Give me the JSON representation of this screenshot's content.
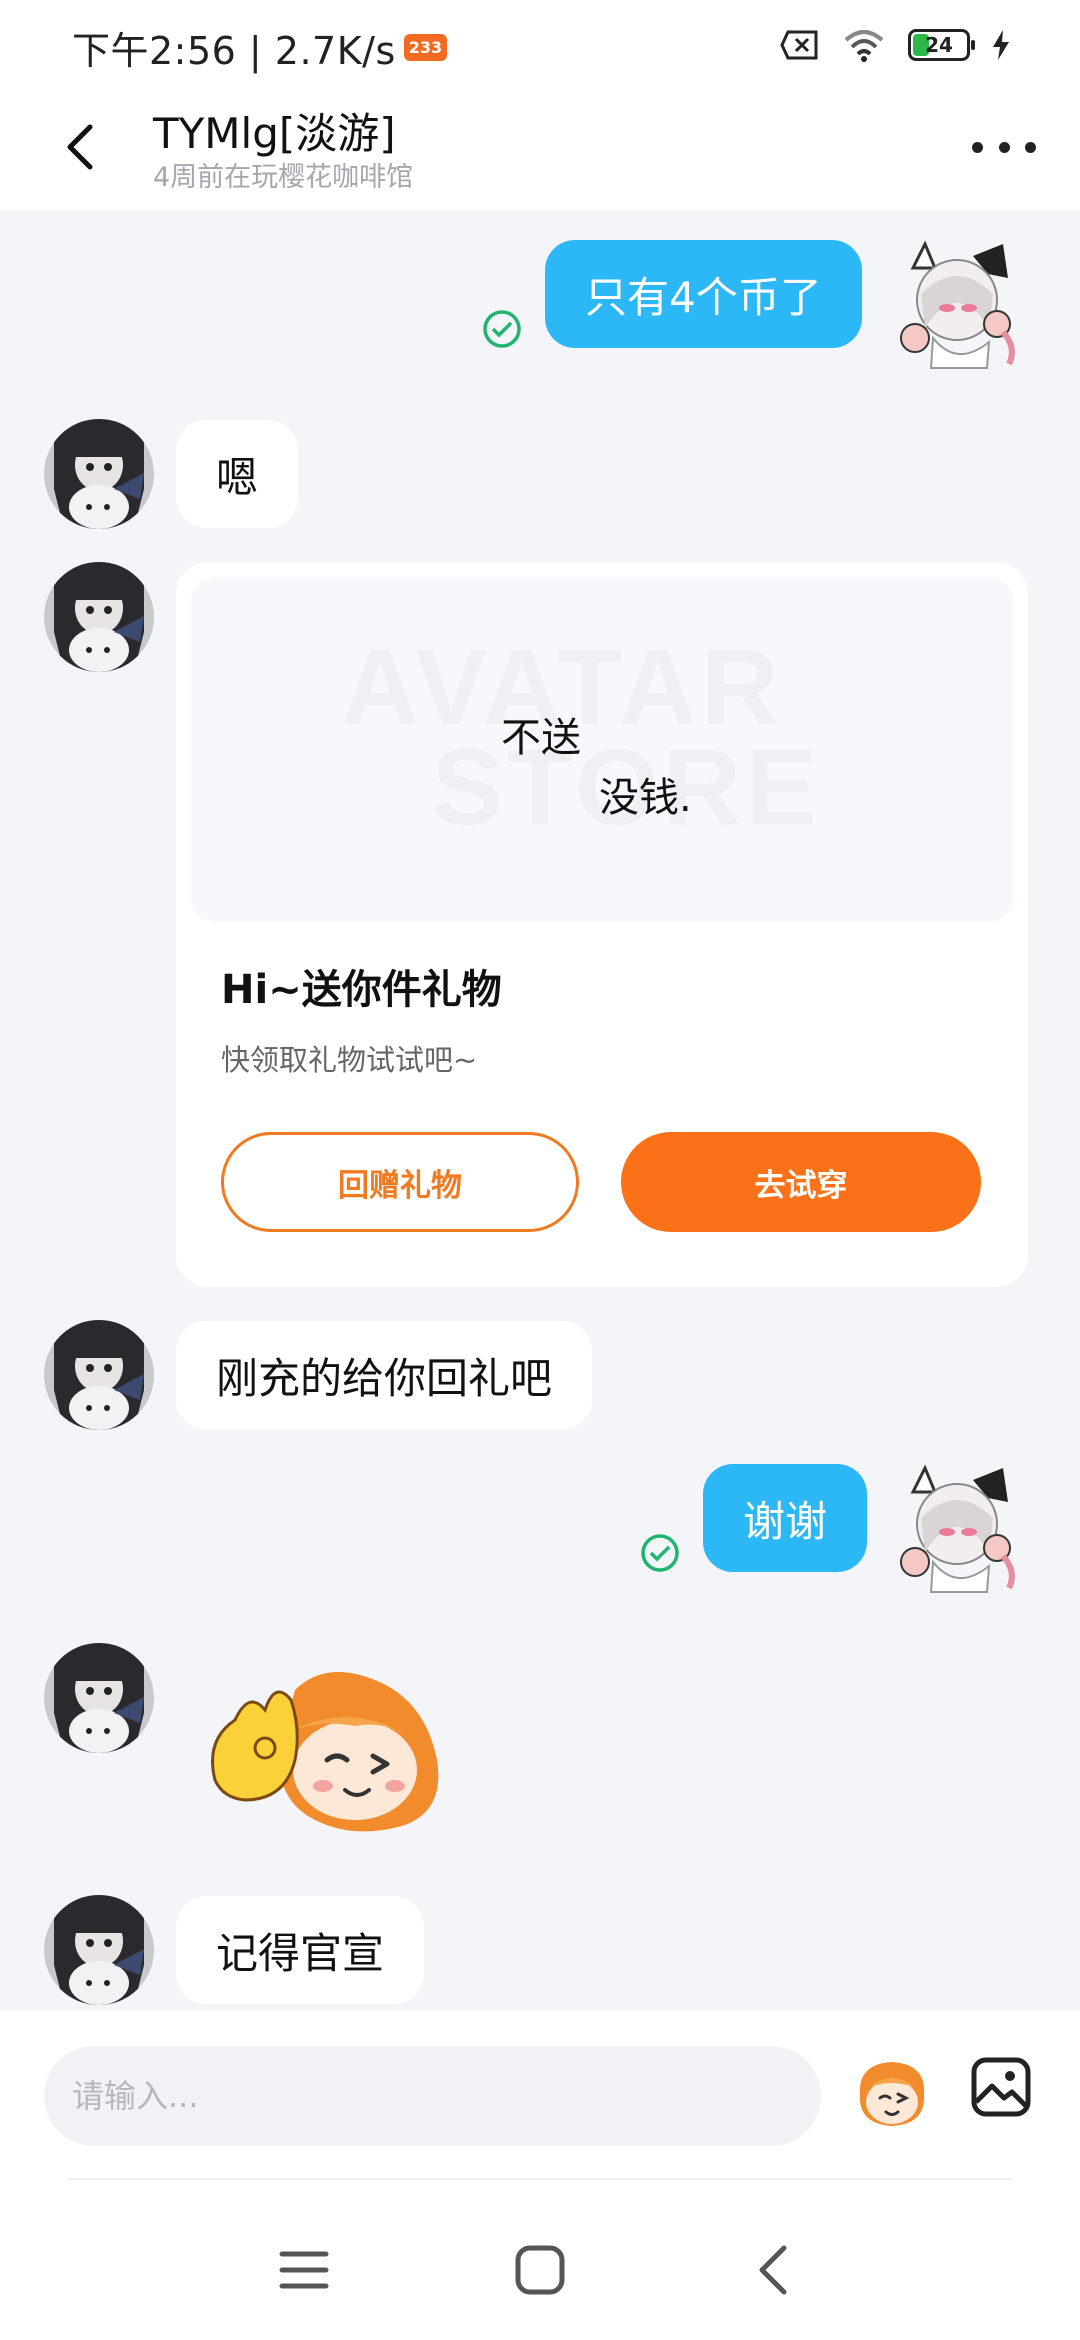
{
  "status_bar": {
    "time_speed": "下午2:56 | 2.7K/s",
    "badge": "233",
    "battery": "24"
  },
  "header": {
    "title": "TYMlg[淡游]",
    "subtitle": "4周前在玩樱花咖啡馆"
  },
  "messages": {
    "m1": "只有4个币了",
    "m2": "嗯",
    "m3": "刚充的给你回礼吧",
    "m4": "谢谢",
    "m5": "记得官宣"
  },
  "gift_card": {
    "watermark_line1": "AVATAR",
    "watermark_line2": "STORE",
    "image_text_1": "不送",
    "image_text_2": "没钱.",
    "title": "Hi~送你件礼物",
    "subtitle": "快领取礼物试试吧~",
    "return_gift_label": "回赠礼物",
    "try_on_label": "去试穿"
  },
  "input": {
    "placeholder": "请输入..."
  },
  "colors": {
    "accent_blue": "#2cb7f6",
    "accent_orange": "#fb7118",
    "background": "#f4f5f9"
  },
  "icons": {
    "back": "chevron-left-icon",
    "more": "more-dots-icon",
    "read": "check-circle-icon",
    "emoji": "emoji-face-icon",
    "image": "image-icon",
    "wifi": "wifi-icon",
    "sim": "sim-x-icon"
  }
}
